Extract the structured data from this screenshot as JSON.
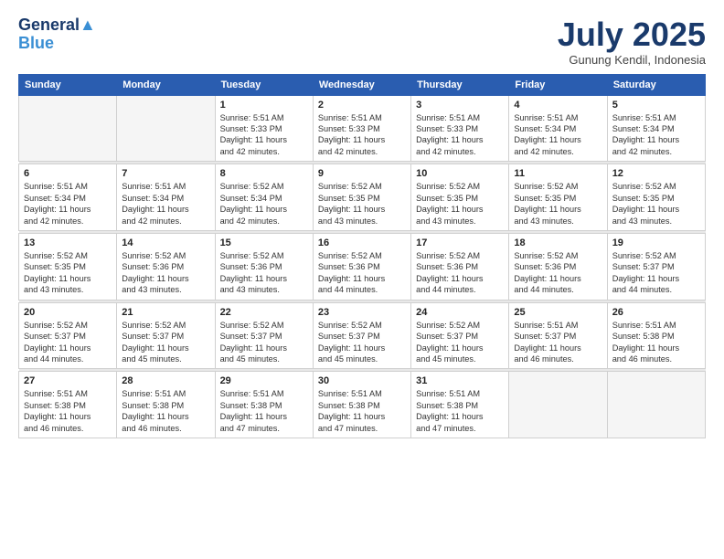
{
  "logo": {
    "line1": "General",
    "line2": "Blue"
  },
  "title": "July 2025",
  "location": "Gunung Kendil, Indonesia",
  "days_header": [
    "Sunday",
    "Monday",
    "Tuesday",
    "Wednesday",
    "Thursday",
    "Friday",
    "Saturday"
  ],
  "weeks": [
    [
      {
        "day": "",
        "info": ""
      },
      {
        "day": "",
        "info": ""
      },
      {
        "day": "1",
        "info": "Sunrise: 5:51 AM\nSunset: 5:33 PM\nDaylight: 11 hours\nand 42 minutes."
      },
      {
        "day": "2",
        "info": "Sunrise: 5:51 AM\nSunset: 5:33 PM\nDaylight: 11 hours\nand 42 minutes."
      },
      {
        "day": "3",
        "info": "Sunrise: 5:51 AM\nSunset: 5:33 PM\nDaylight: 11 hours\nand 42 minutes."
      },
      {
        "day": "4",
        "info": "Sunrise: 5:51 AM\nSunset: 5:34 PM\nDaylight: 11 hours\nand 42 minutes."
      },
      {
        "day": "5",
        "info": "Sunrise: 5:51 AM\nSunset: 5:34 PM\nDaylight: 11 hours\nand 42 minutes."
      }
    ],
    [
      {
        "day": "6",
        "info": "Sunrise: 5:51 AM\nSunset: 5:34 PM\nDaylight: 11 hours\nand 42 minutes."
      },
      {
        "day": "7",
        "info": "Sunrise: 5:51 AM\nSunset: 5:34 PM\nDaylight: 11 hours\nand 42 minutes."
      },
      {
        "day": "8",
        "info": "Sunrise: 5:52 AM\nSunset: 5:34 PM\nDaylight: 11 hours\nand 42 minutes."
      },
      {
        "day": "9",
        "info": "Sunrise: 5:52 AM\nSunset: 5:35 PM\nDaylight: 11 hours\nand 43 minutes."
      },
      {
        "day": "10",
        "info": "Sunrise: 5:52 AM\nSunset: 5:35 PM\nDaylight: 11 hours\nand 43 minutes."
      },
      {
        "day": "11",
        "info": "Sunrise: 5:52 AM\nSunset: 5:35 PM\nDaylight: 11 hours\nand 43 minutes."
      },
      {
        "day": "12",
        "info": "Sunrise: 5:52 AM\nSunset: 5:35 PM\nDaylight: 11 hours\nand 43 minutes."
      }
    ],
    [
      {
        "day": "13",
        "info": "Sunrise: 5:52 AM\nSunset: 5:35 PM\nDaylight: 11 hours\nand 43 minutes."
      },
      {
        "day": "14",
        "info": "Sunrise: 5:52 AM\nSunset: 5:36 PM\nDaylight: 11 hours\nand 43 minutes."
      },
      {
        "day": "15",
        "info": "Sunrise: 5:52 AM\nSunset: 5:36 PM\nDaylight: 11 hours\nand 43 minutes."
      },
      {
        "day": "16",
        "info": "Sunrise: 5:52 AM\nSunset: 5:36 PM\nDaylight: 11 hours\nand 44 minutes."
      },
      {
        "day": "17",
        "info": "Sunrise: 5:52 AM\nSunset: 5:36 PM\nDaylight: 11 hours\nand 44 minutes."
      },
      {
        "day": "18",
        "info": "Sunrise: 5:52 AM\nSunset: 5:36 PM\nDaylight: 11 hours\nand 44 minutes."
      },
      {
        "day": "19",
        "info": "Sunrise: 5:52 AM\nSunset: 5:37 PM\nDaylight: 11 hours\nand 44 minutes."
      }
    ],
    [
      {
        "day": "20",
        "info": "Sunrise: 5:52 AM\nSunset: 5:37 PM\nDaylight: 11 hours\nand 44 minutes."
      },
      {
        "day": "21",
        "info": "Sunrise: 5:52 AM\nSunset: 5:37 PM\nDaylight: 11 hours\nand 45 minutes."
      },
      {
        "day": "22",
        "info": "Sunrise: 5:52 AM\nSunset: 5:37 PM\nDaylight: 11 hours\nand 45 minutes."
      },
      {
        "day": "23",
        "info": "Sunrise: 5:52 AM\nSunset: 5:37 PM\nDaylight: 11 hours\nand 45 minutes."
      },
      {
        "day": "24",
        "info": "Sunrise: 5:52 AM\nSunset: 5:37 PM\nDaylight: 11 hours\nand 45 minutes."
      },
      {
        "day": "25",
        "info": "Sunrise: 5:51 AM\nSunset: 5:37 PM\nDaylight: 11 hours\nand 46 minutes."
      },
      {
        "day": "26",
        "info": "Sunrise: 5:51 AM\nSunset: 5:38 PM\nDaylight: 11 hours\nand 46 minutes."
      }
    ],
    [
      {
        "day": "27",
        "info": "Sunrise: 5:51 AM\nSunset: 5:38 PM\nDaylight: 11 hours\nand 46 minutes."
      },
      {
        "day": "28",
        "info": "Sunrise: 5:51 AM\nSunset: 5:38 PM\nDaylight: 11 hours\nand 46 minutes."
      },
      {
        "day": "29",
        "info": "Sunrise: 5:51 AM\nSunset: 5:38 PM\nDaylight: 11 hours\nand 47 minutes."
      },
      {
        "day": "30",
        "info": "Sunrise: 5:51 AM\nSunset: 5:38 PM\nDaylight: 11 hours\nand 47 minutes."
      },
      {
        "day": "31",
        "info": "Sunrise: 5:51 AM\nSunset: 5:38 PM\nDaylight: 11 hours\nand 47 minutes."
      },
      {
        "day": "",
        "info": ""
      },
      {
        "day": "",
        "info": ""
      }
    ]
  ]
}
